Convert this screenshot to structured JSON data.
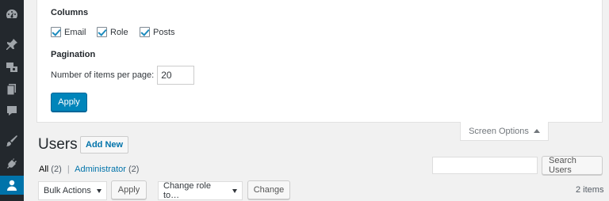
{
  "sidebar": {
    "icons": [
      "dashboard-icon",
      "pin-icon",
      "media-icon",
      "pages-icon",
      "comments-icon",
      "appearance-icon",
      "plugins-icon",
      "users-icon"
    ]
  },
  "screen_options": {
    "columns_legend": "Columns",
    "columns": [
      {
        "label": "Email",
        "checked": true
      },
      {
        "label": "Role",
        "checked": true
      },
      {
        "label": "Posts",
        "checked": true
      }
    ],
    "pagination_legend": "Pagination",
    "per_page_label": "Number of items per page:",
    "per_page_value": "20",
    "apply_label": "Apply",
    "tab_label": "Screen Options"
  },
  "page": {
    "title": "Users",
    "add_new_label": "Add New"
  },
  "views": {
    "all_label": "All",
    "all_count": "(2)",
    "separator": "|",
    "admin_label": "Administrator",
    "admin_count": "(2)"
  },
  "search": {
    "value": "",
    "button_label": "Search Users"
  },
  "bulk": {
    "selected": "Bulk Actions",
    "apply_label": "Apply"
  },
  "role_change": {
    "selected": "Change role to…",
    "button_label": "Change"
  },
  "items_count": "2 items",
  "colors": {
    "accent": "#0073aa",
    "primary_button": "#0085ba",
    "sidebar_bg": "#23282d"
  }
}
